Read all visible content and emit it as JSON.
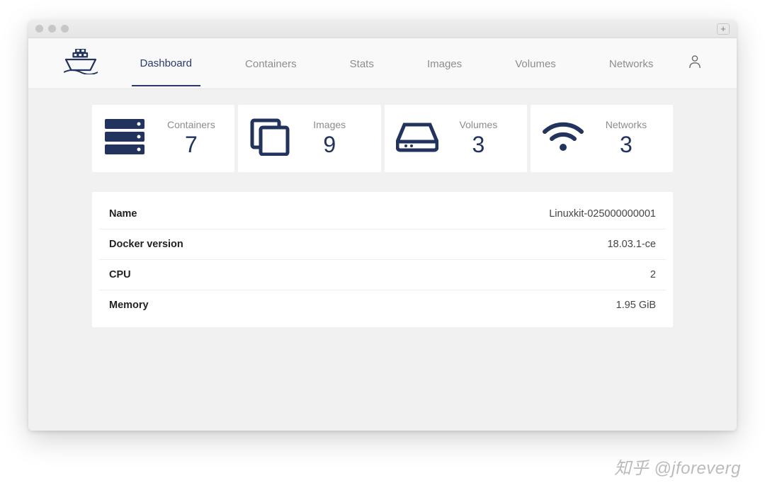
{
  "nav": {
    "tabs": [
      {
        "label": "Dashboard",
        "active": true
      },
      {
        "label": "Containers",
        "active": false
      },
      {
        "label": "Stats",
        "active": false
      },
      {
        "label": "Images",
        "active": false
      },
      {
        "label": "Volumes",
        "active": false
      },
      {
        "label": "Networks",
        "active": false
      }
    ]
  },
  "summary": {
    "containers": {
      "label": "Containers",
      "value": "7"
    },
    "images": {
      "label": "Images",
      "value": "9"
    },
    "volumes": {
      "label": "Volumes",
      "value": "3"
    },
    "networks": {
      "label": "Networks",
      "value": "3"
    }
  },
  "info": {
    "rows": [
      {
        "key": "Name",
        "value": "Linuxkit-025000000001"
      },
      {
        "key": "Docker version",
        "value": "18.03.1-ce"
      },
      {
        "key": "CPU",
        "value": "2"
      },
      {
        "key": "Memory",
        "value": "1.95 GiB"
      }
    ]
  },
  "watermark": "知乎 @jforeverg"
}
